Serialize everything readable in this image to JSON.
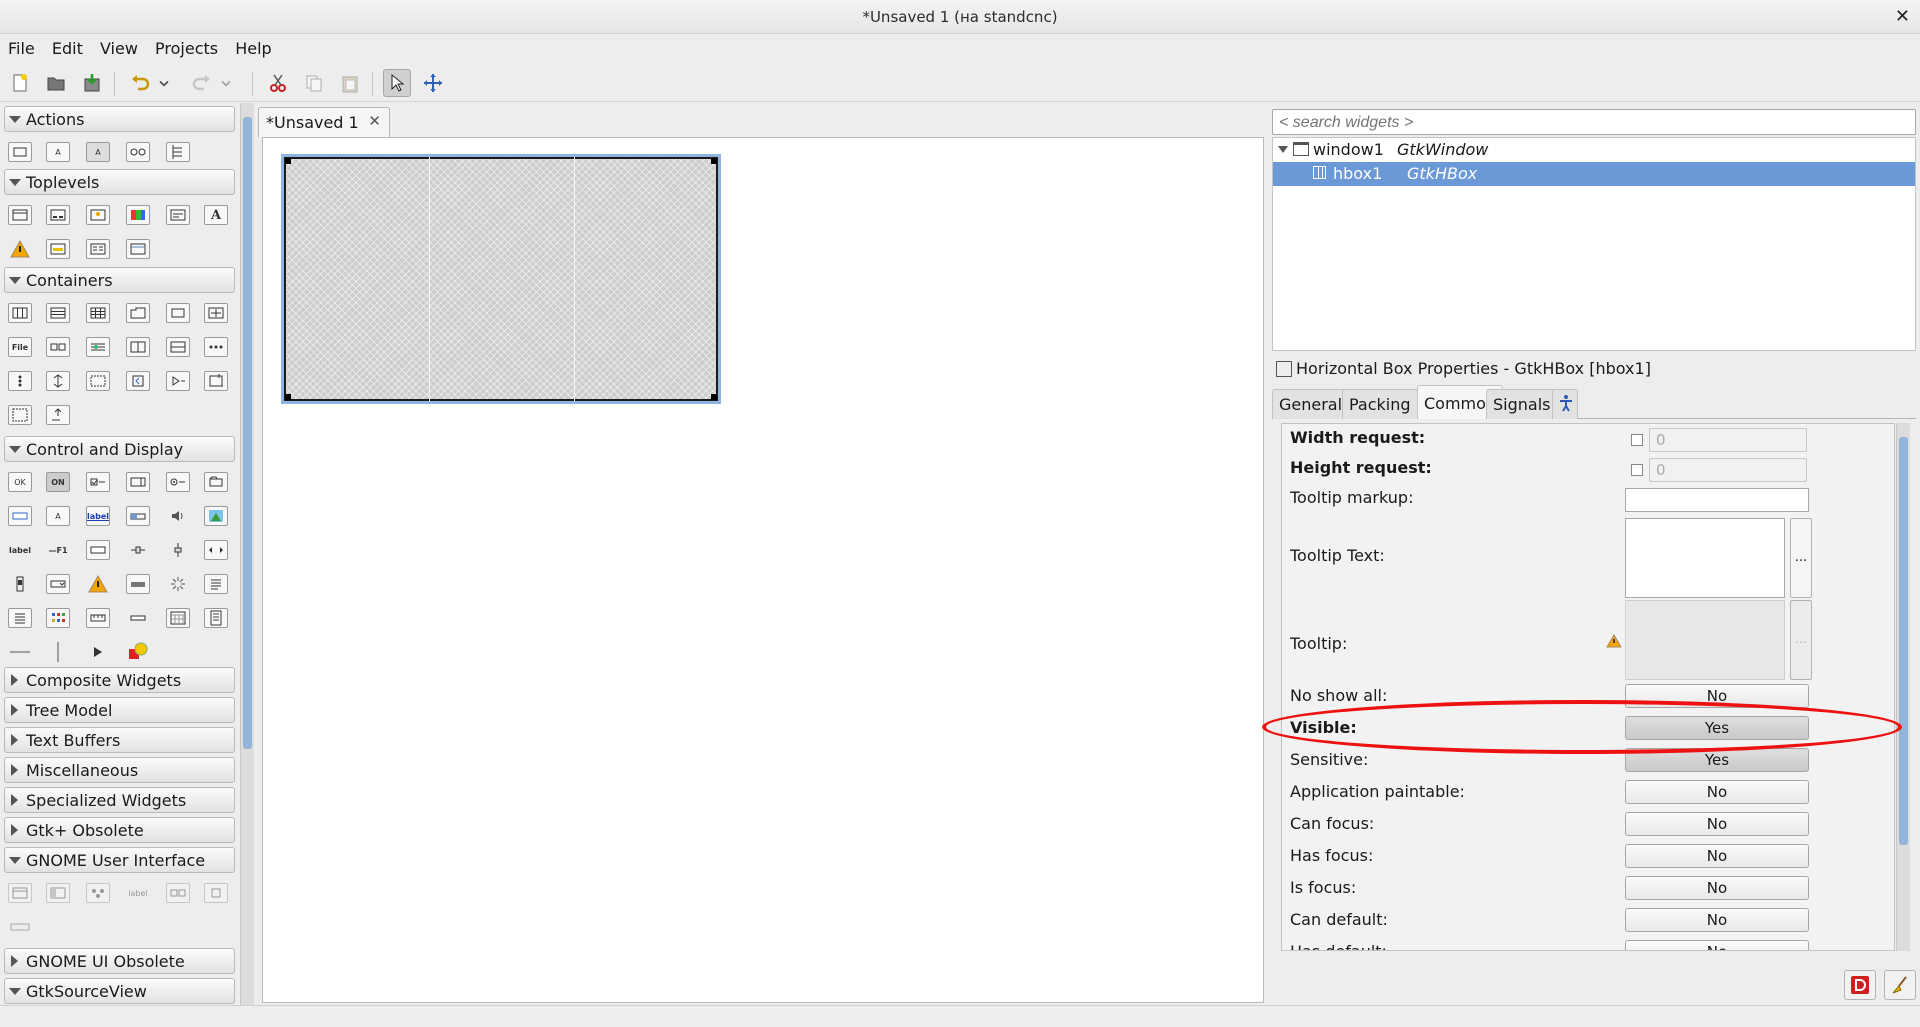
{
  "window": {
    "title": "*Unsaved 1 (на standcnc)",
    "close_glyph": "✕"
  },
  "menu": [
    "File",
    "Edit",
    "View",
    "Projects",
    "Help"
  ],
  "toolbar": {
    "icons": [
      "new-icon",
      "open-icon",
      "save-icon",
      "undo-icon",
      "undo-dropdown-icon",
      "redo-icon",
      "redo-dropdown-icon",
      "cut-icon",
      "copy-icon",
      "paste-icon",
      "select-pointer-icon",
      "drag-resize-icon"
    ],
    "active": "select-pointer-icon"
  },
  "palette": {
    "groups": [
      {
        "label": "Actions",
        "expanded": true
      },
      {
        "label": "Toplevels",
        "expanded": true
      },
      {
        "label": "Containers",
        "expanded": true
      },
      {
        "label": "Control and Display",
        "expanded": true
      },
      {
        "label": "Composite Widgets",
        "expanded": false
      },
      {
        "label": "Tree Model",
        "expanded": false
      },
      {
        "label": "Text Buffers",
        "expanded": false
      },
      {
        "label": "Miscellaneous",
        "expanded": false
      },
      {
        "label": "Specialized Widgets",
        "expanded": false
      },
      {
        "label": "Gtk+ Obsolete",
        "expanded": false
      },
      {
        "label": "GNOME User Interface",
        "expanded": true
      },
      {
        "label": "GNOME UI Obsolete",
        "expanded": false
      },
      {
        "label": "GtkSourceView",
        "expanded": true
      }
    ],
    "glyphs": {
      "file": "File",
      "label": "label",
      "ok": "OK",
      "on": "ON",
      "a": "A",
      "f1": "—F1"
    }
  },
  "document": {
    "tab_label": "*Unsaved 1",
    "tab_close": "✕"
  },
  "inspector": {
    "search_placeholder": "< search widgets >",
    "tree": [
      {
        "name": "window1",
        "type": "GtkWindow",
        "selected": false
      },
      {
        "name": "hbox1",
        "type": "GtkHBox",
        "selected": true
      }
    ],
    "properties_title": "Horizontal Box Properties - GtkHBox [hbox1]",
    "tabs": [
      "General",
      "Packing",
      "Common",
      "Signals"
    ],
    "active_tab": "Common",
    "rows": {
      "width_request": {
        "label": "Width request:",
        "value": "0"
      },
      "height_request": {
        "label": "Height request:",
        "value": "0"
      },
      "tooltip_markup": {
        "label": "Tooltip markup:"
      },
      "tooltip_text": {
        "label": "Tooltip Text:",
        "ellipsis": "..."
      },
      "tooltip": {
        "label": "Tooltip:",
        "ellipsis": "..."
      },
      "no_show_all": {
        "label": "No show all:",
        "value": "No"
      },
      "visible": {
        "label": "Visible:",
        "value": "Yes"
      },
      "sensitive": {
        "label": "Sensitive:",
        "value": "Yes"
      },
      "app_paintable": {
        "label": "Application paintable:",
        "value": "No"
      },
      "can_focus": {
        "label": "Can focus:",
        "value": "No"
      },
      "has_focus": {
        "label": "Has focus:",
        "value": "No"
      },
      "is_focus": {
        "label": "Is focus:",
        "value": "No"
      },
      "can_default": {
        "label": "Can default:",
        "value": "No"
      },
      "has_default": {
        "label": "Has default:",
        "value": "No"
      }
    }
  },
  "colors": {
    "selection": "#6b98d6",
    "highlight_ring": "#ee1111",
    "widget_border": "#8fb4e2"
  }
}
